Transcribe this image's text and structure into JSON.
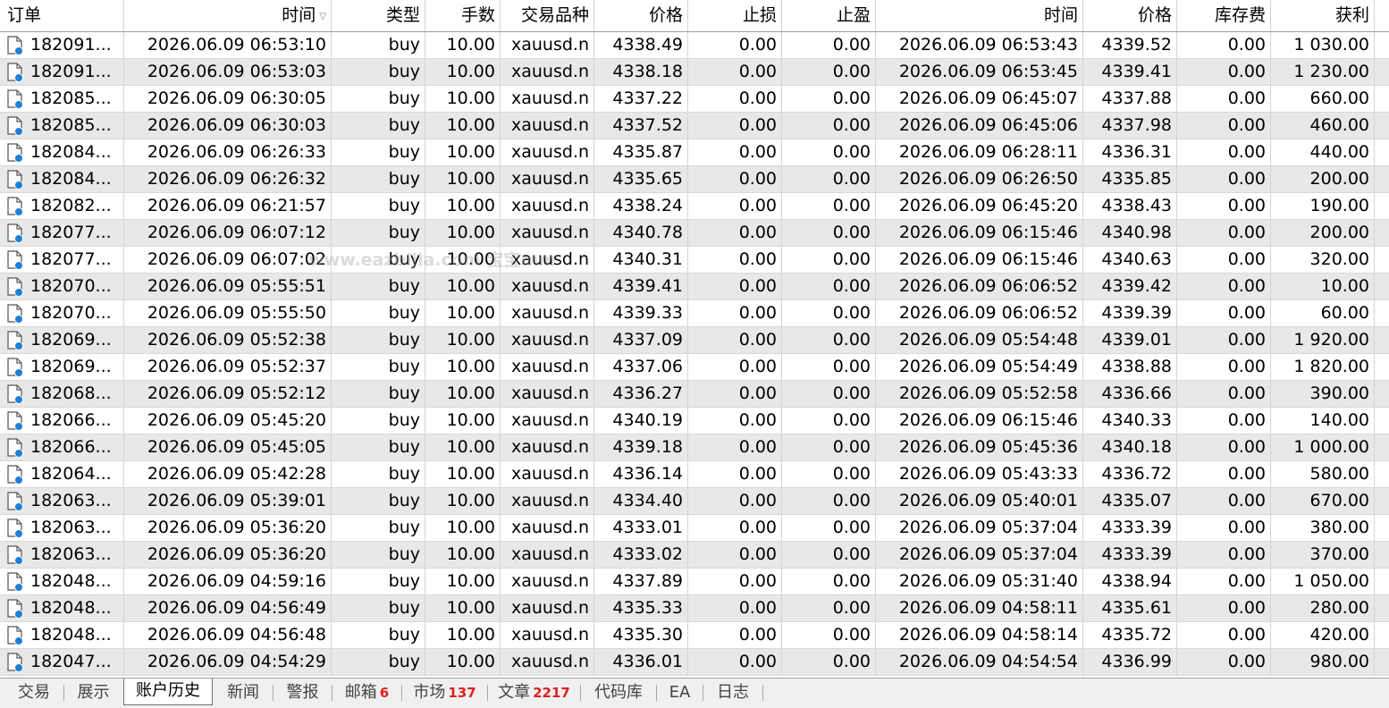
{
  "columns": [
    {
      "label": "订单",
      "align": "left"
    },
    {
      "label": "时间",
      "align": "right",
      "sort_icon": "sort-descending-icon"
    },
    {
      "label": "类型",
      "align": "right"
    },
    {
      "label": "手数",
      "align": "right"
    },
    {
      "label": "交易品种",
      "align": "right"
    },
    {
      "label": "价格",
      "align": "right"
    },
    {
      "label": "止损",
      "align": "right"
    },
    {
      "label": "止盈",
      "align": "right"
    },
    {
      "label": "时间",
      "align": "right"
    },
    {
      "label": "价格",
      "align": "right"
    },
    {
      "label": "库存费",
      "align": "right"
    },
    {
      "label": "获利",
      "align": "right"
    }
  ],
  "rows": [
    [
      "182091...",
      "2026.06.09 06:53:10",
      "buy",
      "10.00",
      "xauusd.n",
      "4338.49",
      "0.00",
      "0.00",
      "2026.06.09 06:53:43",
      "4339.52",
      "0.00",
      "1 030.00"
    ],
    [
      "182091...",
      "2026.06.09 06:53:03",
      "buy",
      "10.00",
      "xauusd.n",
      "4338.18",
      "0.00",
      "0.00",
      "2026.06.09 06:53:45",
      "4339.41",
      "0.00",
      "1 230.00"
    ],
    [
      "182085...",
      "2026.06.09 06:30:05",
      "buy",
      "10.00",
      "xauusd.n",
      "4337.22",
      "0.00",
      "0.00",
      "2026.06.09 06:45:07",
      "4337.88",
      "0.00",
      "660.00"
    ],
    [
      "182085...",
      "2026.06.09 06:30:03",
      "buy",
      "10.00",
      "xauusd.n",
      "4337.52",
      "0.00",
      "0.00",
      "2026.06.09 06:45:06",
      "4337.98",
      "0.00",
      "460.00"
    ],
    [
      "182084...",
      "2026.06.09 06:26:33",
      "buy",
      "10.00",
      "xauusd.n",
      "4335.87",
      "0.00",
      "0.00",
      "2026.06.09 06:28:11",
      "4336.31",
      "0.00",
      "440.00"
    ],
    [
      "182084...",
      "2026.06.09 06:26:32",
      "buy",
      "10.00",
      "xauusd.n",
      "4335.65",
      "0.00",
      "0.00",
      "2026.06.09 06:26:50",
      "4335.85",
      "0.00",
      "200.00"
    ],
    [
      "182082...",
      "2026.06.09 06:21:57",
      "buy",
      "10.00",
      "xauusd.n",
      "4338.24",
      "0.00",
      "0.00",
      "2026.06.09 06:45:20",
      "4338.43",
      "0.00",
      "190.00"
    ],
    [
      "182077...",
      "2026.06.09 06:07:12",
      "buy",
      "10.00",
      "xauusd.n",
      "4340.78",
      "0.00",
      "0.00",
      "2026.06.09 06:15:46",
      "4340.98",
      "0.00",
      "200.00"
    ],
    [
      "182077...",
      "2026.06.09 06:07:02",
      "buy",
      "10.00",
      "xauusd.n",
      "4340.31",
      "0.00",
      "0.00",
      "2026.06.09 06:15:46",
      "4340.63",
      "0.00",
      "320.00"
    ],
    [
      "182070...",
      "2026.06.09 05:55:51",
      "buy",
      "10.00",
      "xauusd.n",
      "4339.41",
      "0.00",
      "0.00",
      "2026.06.09 06:06:52",
      "4339.42",
      "0.00",
      "10.00"
    ],
    [
      "182070...",
      "2026.06.09 05:55:50",
      "buy",
      "10.00",
      "xauusd.n",
      "4339.33",
      "0.00",
      "0.00",
      "2026.06.09 06:06:52",
      "4339.39",
      "0.00",
      "60.00"
    ],
    [
      "182069...",
      "2026.06.09 05:52:38",
      "buy",
      "10.00",
      "xauusd.n",
      "4337.09",
      "0.00",
      "0.00",
      "2026.06.09 05:54:48",
      "4339.01",
      "0.00",
      "1 920.00"
    ],
    [
      "182069...",
      "2026.06.09 05:52:37",
      "buy",
      "10.00",
      "xauusd.n",
      "4337.06",
      "0.00",
      "0.00",
      "2026.06.09 05:54:49",
      "4338.88",
      "0.00",
      "1 820.00"
    ],
    [
      "182068...",
      "2026.06.09 05:52:12",
      "buy",
      "10.00",
      "xauusd.n",
      "4336.27",
      "0.00",
      "0.00",
      "2026.06.09 05:52:58",
      "4336.66",
      "0.00",
      "390.00"
    ],
    [
      "182066...",
      "2026.06.09 05:45:20",
      "buy",
      "10.00",
      "xauusd.n",
      "4340.19",
      "0.00",
      "0.00",
      "2026.06.09 06:15:46",
      "4340.33",
      "0.00",
      "140.00"
    ],
    [
      "182066...",
      "2026.06.09 05:45:05",
      "buy",
      "10.00",
      "xauusd.n",
      "4339.18",
      "0.00",
      "0.00",
      "2026.06.09 05:45:36",
      "4340.18",
      "0.00",
      "1 000.00"
    ],
    [
      "182064...",
      "2026.06.09 05:42:28",
      "buy",
      "10.00",
      "xauusd.n",
      "4336.14",
      "0.00",
      "0.00",
      "2026.06.09 05:43:33",
      "4336.72",
      "0.00",
      "580.00"
    ],
    [
      "182063...",
      "2026.06.09 05:39:01",
      "buy",
      "10.00",
      "xauusd.n",
      "4334.40",
      "0.00",
      "0.00",
      "2026.06.09 05:40:01",
      "4335.07",
      "0.00",
      "670.00"
    ],
    [
      "182063...",
      "2026.06.09 05:36:20",
      "buy",
      "10.00",
      "xauusd.n",
      "4333.01",
      "0.00",
      "0.00",
      "2026.06.09 05:37:04",
      "4333.39",
      "0.00",
      "380.00"
    ],
    [
      "182063...",
      "2026.06.09 05:36:20",
      "buy",
      "10.00",
      "xauusd.n",
      "4333.02",
      "0.00",
      "0.00",
      "2026.06.09 05:37:04",
      "4333.39",
      "0.00",
      "370.00"
    ],
    [
      "182048...",
      "2026.06.09 04:59:16",
      "buy",
      "10.00",
      "xauusd.n",
      "4337.89",
      "0.00",
      "0.00",
      "2026.06.09 05:31:40",
      "4338.94",
      "0.00",
      "1 050.00"
    ],
    [
      "182048...",
      "2026.06.09 04:56:49",
      "buy",
      "10.00",
      "xauusd.n",
      "4335.33",
      "0.00",
      "0.00",
      "2026.06.09 04:58:11",
      "4335.61",
      "0.00",
      "280.00"
    ],
    [
      "182048...",
      "2026.06.09 04:56:48",
      "buy",
      "10.00",
      "xauusd.n",
      "4335.30",
      "0.00",
      "0.00",
      "2026.06.09 04:58:14",
      "4335.72",
      "0.00",
      "420.00"
    ],
    [
      "182047...",
      "2026.06.09 04:54:29",
      "buy",
      "10.00",
      "xauusd.n",
      "4336.01",
      "0.00",
      "0.00",
      "2026.06.09 04:54:54",
      "4336.99",
      "0.00",
      "980.00"
    ]
  ],
  "row_icon": "order-document-icon",
  "tabs": [
    {
      "label": "交易",
      "badge": "",
      "active": false
    },
    {
      "label": "展示",
      "badge": "",
      "active": false
    },
    {
      "label": "账户历史",
      "badge": "",
      "active": true
    },
    {
      "label": "新闻",
      "badge": "",
      "active": false
    },
    {
      "label": "警报",
      "badge": "",
      "active": false
    },
    {
      "label": "邮箱",
      "badge": "6",
      "active": false
    },
    {
      "label": "市场",
      "badge": "137",
      "active": false
    },
    {
      "label": "文章",
      "badge": "2217",
      "active": false
    },
    {
      "label": "代码库",
      "badge": "",
      "active": false
    },
    {
      "label": "EA",
      "badge": "",
      "active": false
    },
    {
      "label": "日志",
      "badge": "",
      "active": false
    }
  ],
  "watermark": "www.eazbijia.com 宝宝mm",
  "colors": {
    "badge": "#e02020",
    "row_alt": "#e8e8e8",
    "icon_accent": "#1e7fd8"
  }
}
